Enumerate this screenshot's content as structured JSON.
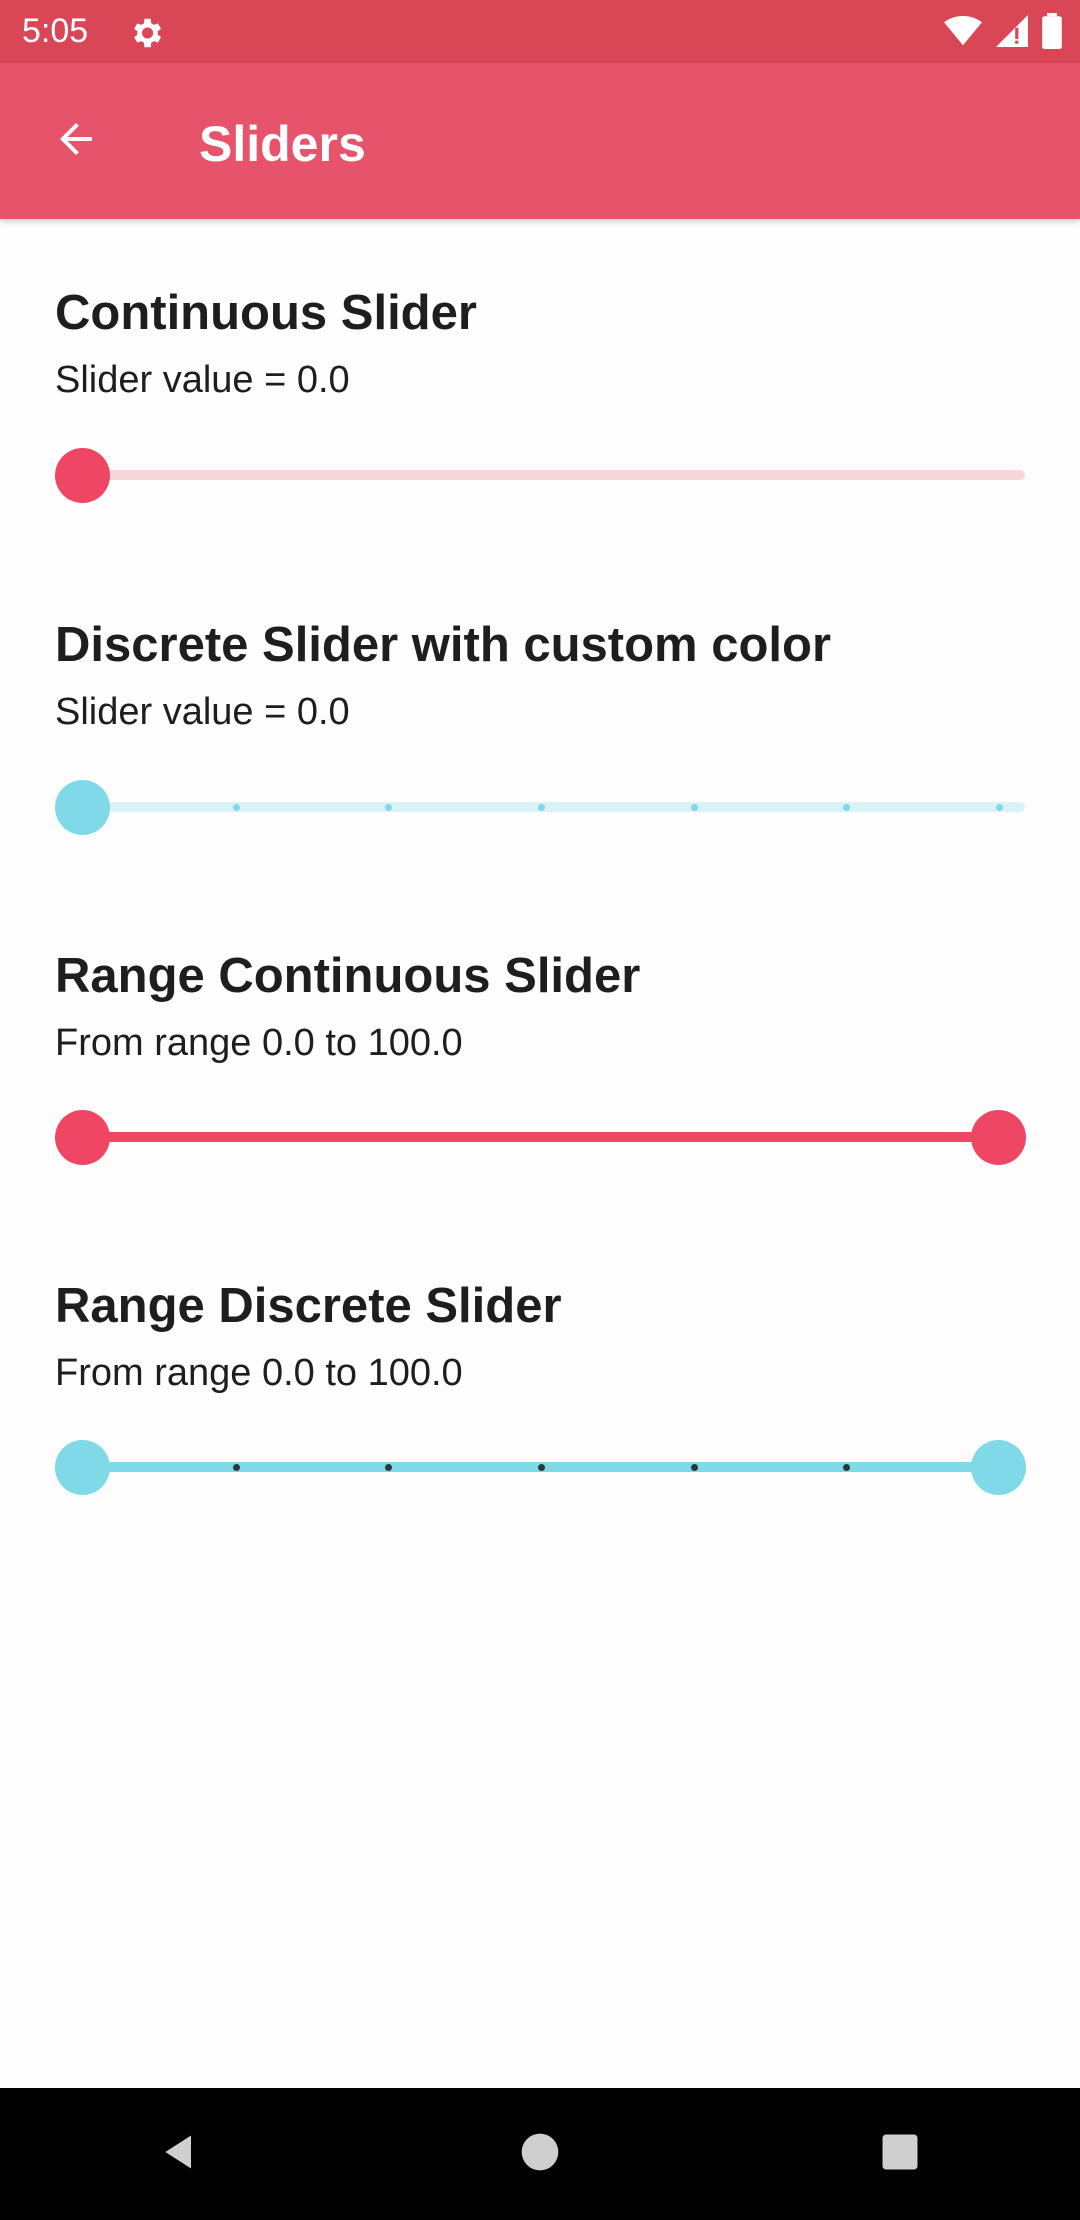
{
  "status_bar": {
    "time": "5:05",
    "icons": [
      "settings-icon",
      "wifi-icon",
      "signal-icon",
      "battery-icon"
    ]
  },
  "app_bar": {
    "title": "Sliders",
    "back_icon": "arrow-back-icon"
  },
  "colors": {
    "primary": "#e7536a",
    "primary_dark": "#d94656",
    "accent": "#ef4663",
    "cyan": "#7fd9e6",
    "track_light_red": "#f7d6db",
    "track_light_cyan": "#d9f2f6"
  },
  "sections": [
    {
      "title": "Continuous Slider",
      "value_label": "Slider value =  0.0",
      "slider": {
        "type": "continuous",
        "value": 0.0,
        "min": 0,
        "max": 100
      }
    },
    {
      "title": "Discrete Slider with custom color",
      "value_label": "Slider value =  0.0",
      "slider": {
        "type": "discrete",
        "value": 0.0,
        "min": 0,
        "max": 100,
        "ticks": 7
      }
    },
    {
      "title": "Range Continuous Slider",
      "value_label": "From range  0.0  to  100.0",
      "slider": {
        "type": "range-continuous",
        "from": 0.0,
        "to": 100.0,
        "min": 0,
        "max": 100
      }
    },
    {
      "title": "Range Discrete Slider",
      "value_label": "From range  0.0  to  100.0",
      "slider": {
        "type": "range-discrete",
        "from": 0.0,
        "to": 100.0,
        "min": 0,
        "max": 100,
        "ticks": 7
      }
    }
  ],
  "nav_bar": {
    "buttons": [
      "back-icon",
      "home-icon",
      "recents-icon"
    ]
  }
}
